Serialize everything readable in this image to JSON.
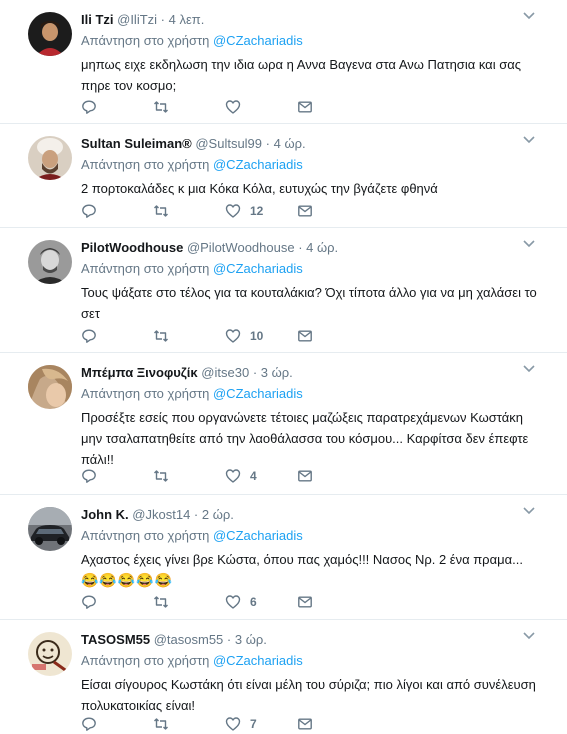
{
  "reply_prefix": "Απάντηση στο χρήστη",
  "tweets": [
    {
      "name": "Ili Tzi",
      "handle": "@IliTzi",
      "time": "4 λεπ.",
      "reply_to": "@CZachariadis",
      "text": "μηπως ειχε εκδηλωση την ιδια ωρα η Αννα Βαγενα στα Ανω Πατησια και σας πηρε τον κοσμο;",
      "likes": "",
      "avatar_icon": "avatar-dark-bg-icon"
    },
    {
      "name": "Sultan Suleiman®",
      "handle": "@Sultsul99",
      "time": "4 ώρ.",
      "reply_to": "@CZachariadis",
      "text": "2 πορτοκαλάδες κ μια Κόκα Κόλα, ευτυχώς την βγάζετε φθηνά",
      "likes": "12",
      "avatar_icon": "avatar-turban-icon"
    },
    {
      "name": "PilotWoodhouse",
      "handle": "@PilotWoodhouse",
      "time": "4 ώρ.",
      "reply_to": "@CZachariadis",
      "text": "Τους ψάξατε στο τέλος για τα κουταλάκια? Όχι τίποτα άλλο για να μη χαλάσει το σετ",
      "likes": "10",
      "avatar_icon": "avatar-bw-portrait-icon"
    },
    {
      "name": "Μπέμπα Ξινοφυζίκ",
      "handle": "@itse30",
      "time": "3 ώρ.",
      "reply_to": "@CZachariadis",
      "text": "Προσέξτε εσείς που οργανώνετε τέτοιες μαζώξεις παρατρεχάμενων Κωστάκη μην τσαλαπατηθείτε από την λαοθάλασσα του κόσμου... Καρφίτσα δεν έπεφτε πάλι!!",
      "likes": "4",
      "avatar_icon": "avatar-blonde-hair-icon"
    },
    {
      "name": "John K.",
      "handle": "@Jkost14",
      "time": "2 ώρ.",
      "reply_to": "@CZachariadis",
      "text": "Αχαστος έχεις γίνει βρε Κώστα, όπου πας χαμός!!! Νασος Νρ. 2 ένα πραμα...",
      "emoji": "😂😂😂😂😂",
      "likes": "6",
      "avatar_icon": "avatar-car-icon"
    },
    {
      "name": "TASOSM55",
      "handle": "@tasosm55",
      "time": "3 ώρ.",
      "reply_to": "@CZachariadis",
      "text": "Είσαι σίγουρος Κωστάκη ότι είναι μέλη του σύριζα; πιο λίγοι και από συνέλευση πολυκατοικίας είναι!",
      "likes": "7",
      "avatar_icon": "avatar-cartoon-icon"
    }
  ]
}
